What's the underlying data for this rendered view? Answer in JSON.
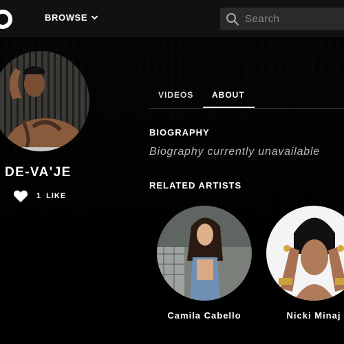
{
  "header": {
    "browse_label": "BROWSE",
    "search_placeholder": "Search"
  },
  "artist": {
    "name": "DE-VA'JE",
    "like_count": "1",
    "like_label": "LIKE"
  },
  "tabs": [
    {
      "label": "VIDEOS",
      "active": false
    },
    {
      "label": "ABOUT",
      "active": true
    }
  ],
  "about": {
    "biography_heading": "BIOGRAPHY",
    "biography_text": "Biography currently unavailable",
    "related_heading": "RELATED ARTISTS",
    "related_artists": [
      {
        "name": "Camila Cabello"
      },
      {
        "name": "Nicki Minaj"
      }
    ]
  },
  "colors": {
    "background": "#000000",
    "topbar": "#111111",
    "search_bg": "#2a2a2a",
    "text": "#ffffff",
    "muted_text": "#bbbbbb"
  }
}
